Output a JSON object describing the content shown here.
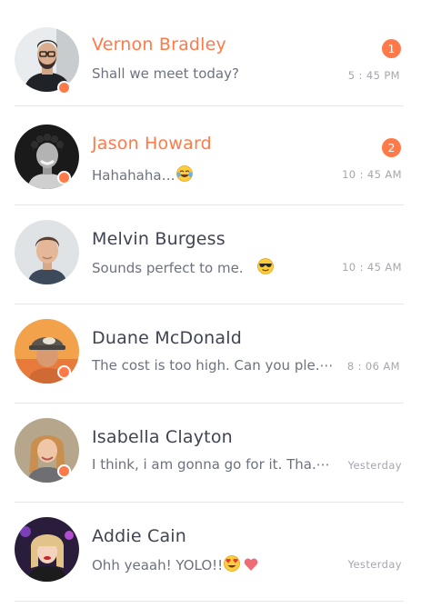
{
  "conversations": [
    {
      "name": "Vernon Bradley",
      "message": "Shall we meet today?",
      "time": "5 : 45 PM",
      "unread_count": "1",
      "online": true,
      "avatar": "man-glasses-beard"
    },
    {
      "name": "Jason Howard",
      "message": "Hahahaha…",
      "time": "10 : 45 AM",
      "unread_count": "2",
      "online": true,
      "avatar": "man-curly-hair-bw",
      "emoji": "tears-of-joy-emoji"
    },
    {
      "name": "Melvin Burgess",
      "message": "Sounds perfect to me.",
      "time": "10 : 45 AM",
      "unread_count": "",
      "online": false,
      "avatar": "young-man-short-hair",
      "emoji": "sunglasses-emoji"
    },
    {
      "name": "Duane McDonald",
      "message": "The cost is too high. Can you ple.⋯",
      "time": "8 : 06 AM",
      "unread_count": "",
      "online": true,
      "avatar": "man-backwards-cap"
    },
    {
      "name": "Isabella Clayton",
      "message": "I think, i am gonna go for it. Tha.⋯",
      "time": "Yesterday",
      "unread_count": "",
      "online": true,
      "avatar": "woman-blonde"
    },
    {
      "name": "Addie Cain",
      "message": "Ohh yeaah! YOLO!!",
      "time": "Yesterday",
      "unread_count": "",
      "online": false,
      "avatar": "woman-blonde-red-lips",
      "emoji": "heart-eyes-emoji",
      "emoji2": "heart-emoji"
    }
  ],
  "colors": {
    "accent": "#ff7a48",
    "text": "#3f4452",
    "muted": "#a4a7b0",
    "divider": "#e6e6ea"
  }
}
